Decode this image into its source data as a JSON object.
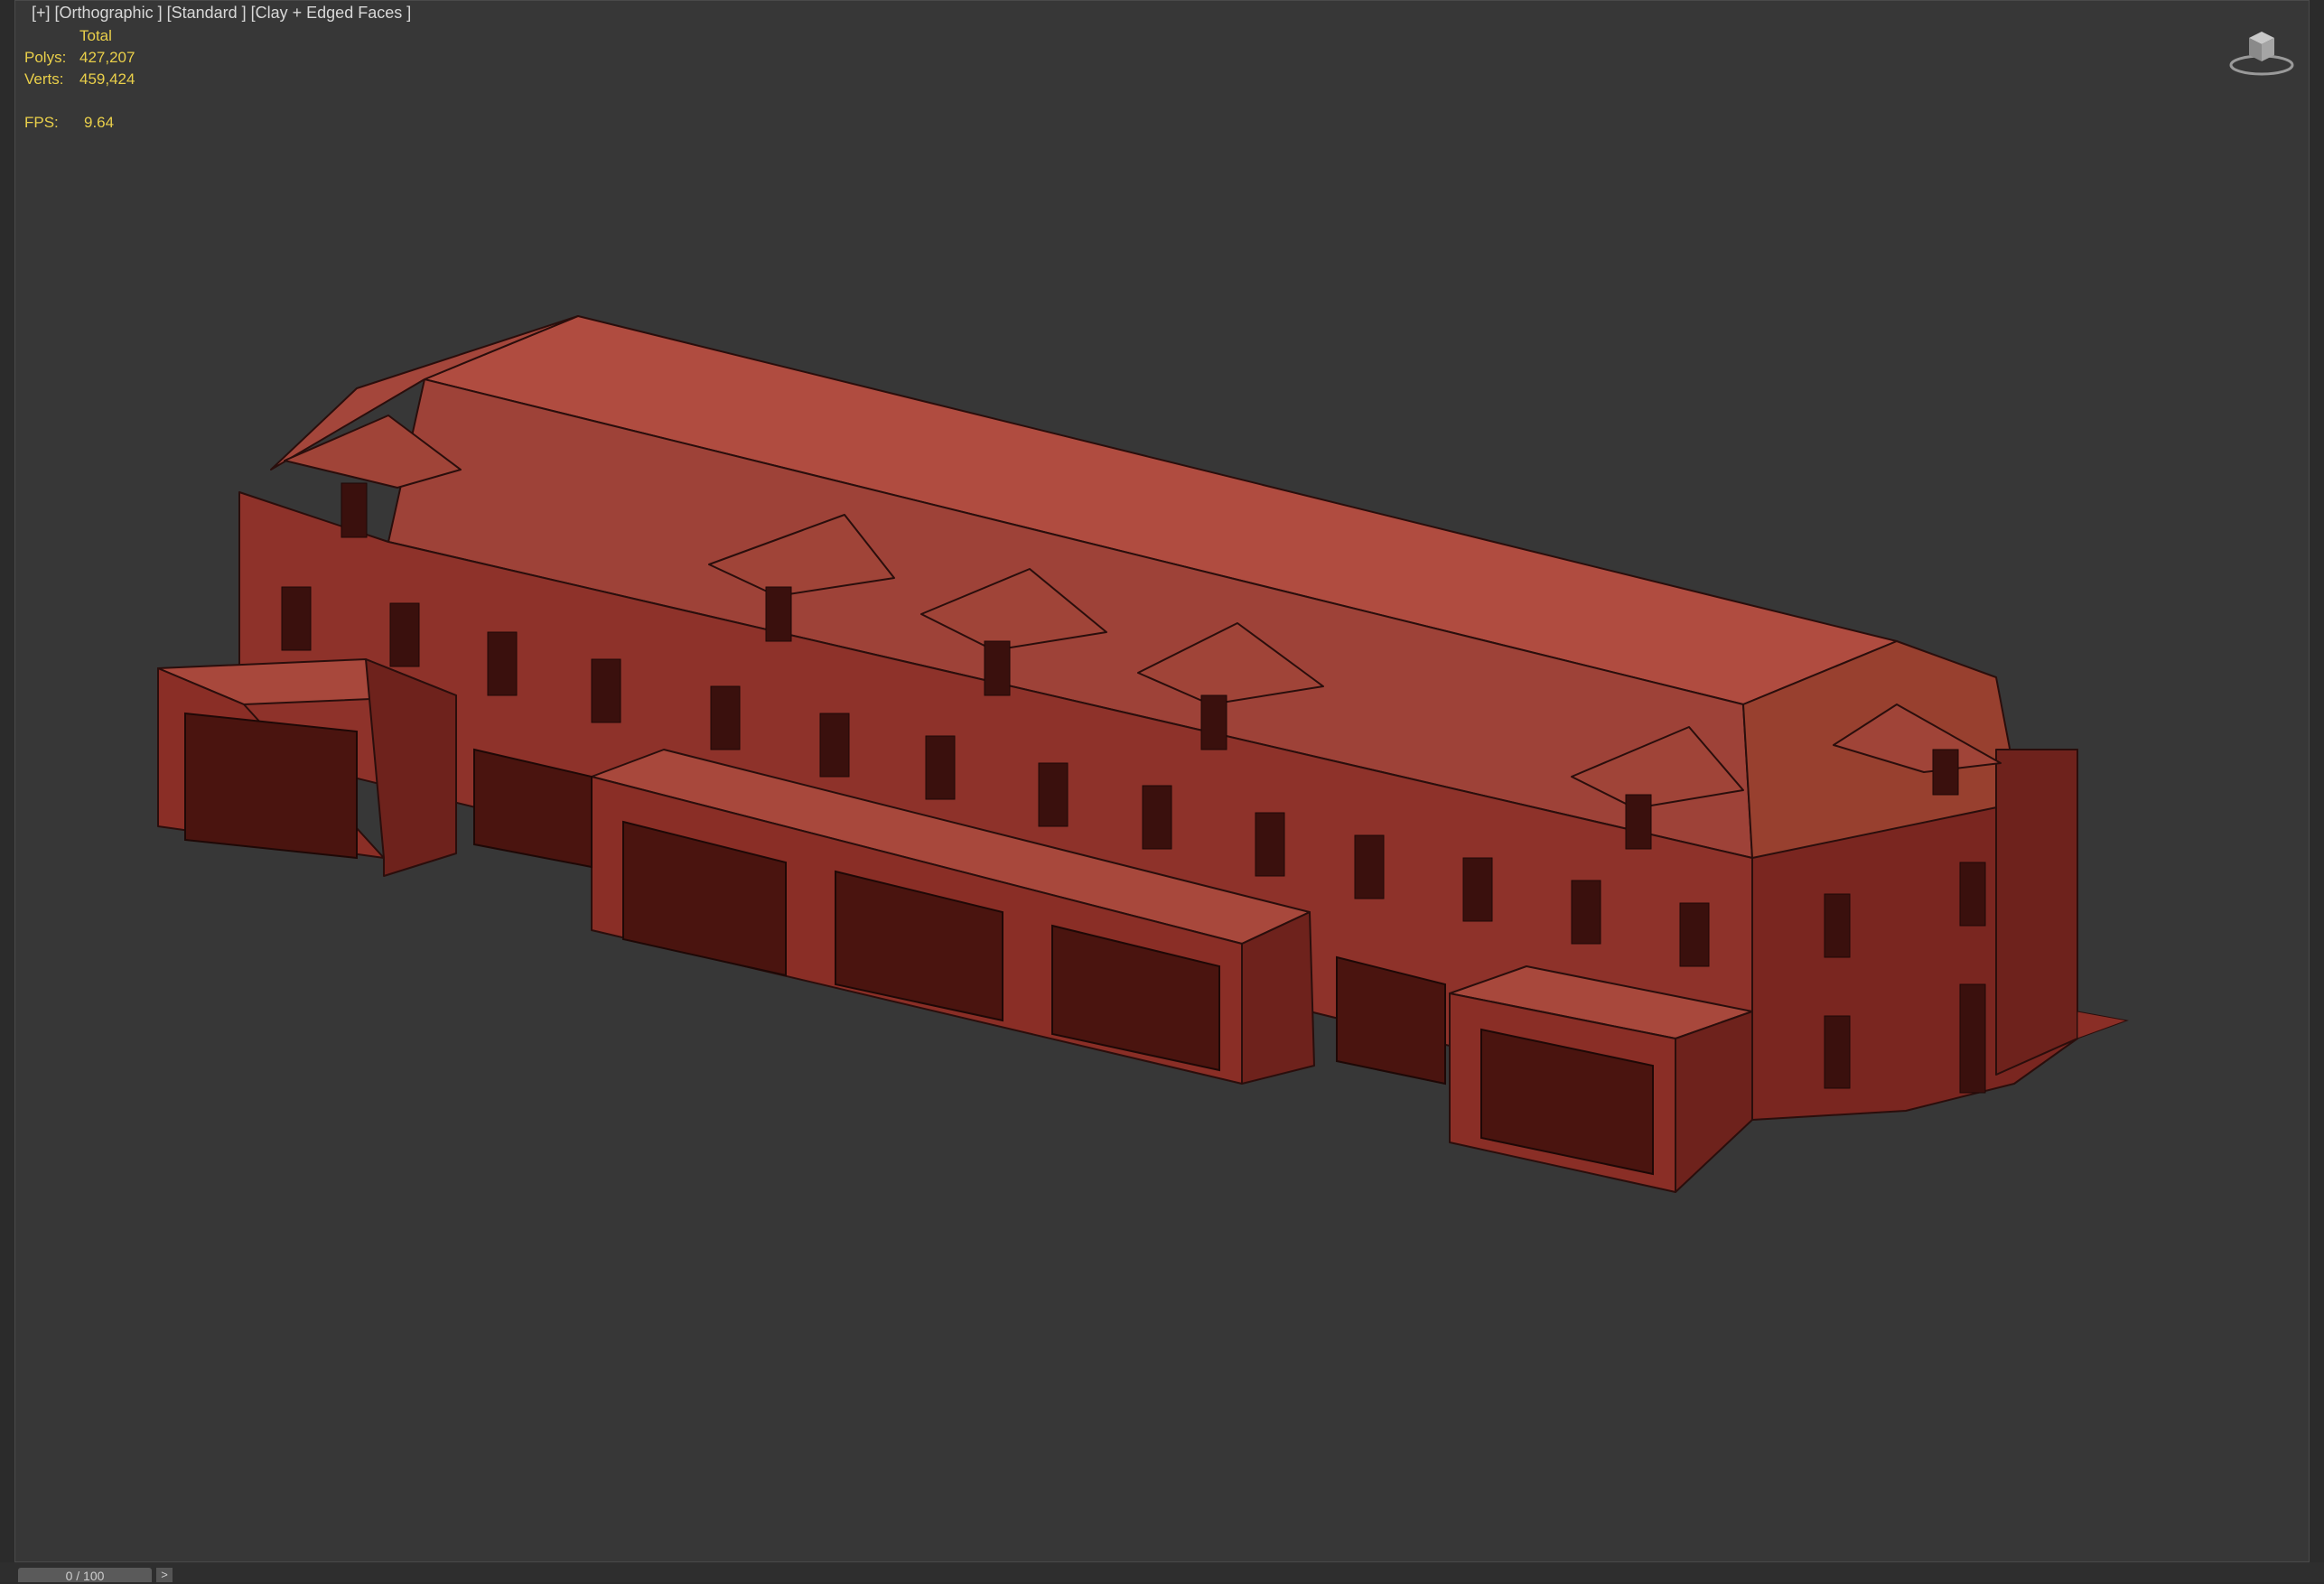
{
  "viewport": {
    "label": "[+] [Orthographic ] [Standard ] [Clay + Edged Faces ]",
    "stats": {
      "header": "Total",
      "polys_label": "Polys:",
      "polys_value": "427,207",
      "verts_label": "Verts:",
      "verts_value": "459,424",
      "fps_label": "FPS:",
      "fps_value": "9.64"
    },
    "viewcube_icon": "viewcube-icon",
    "model": "building",
    "colors": {
      "background": "#373737",
      "stats_text": "#e9cf4a",
      "model_roof": "#a8483c",
      "model_wall": "#7a2620",
      "model_front": "#8e322a",
      "model_edge": "#2a0e0c"
    }
  },
  "timeline": {
    "frame_label": "0 / 100",
    "next_icon": ">"
  }
}
